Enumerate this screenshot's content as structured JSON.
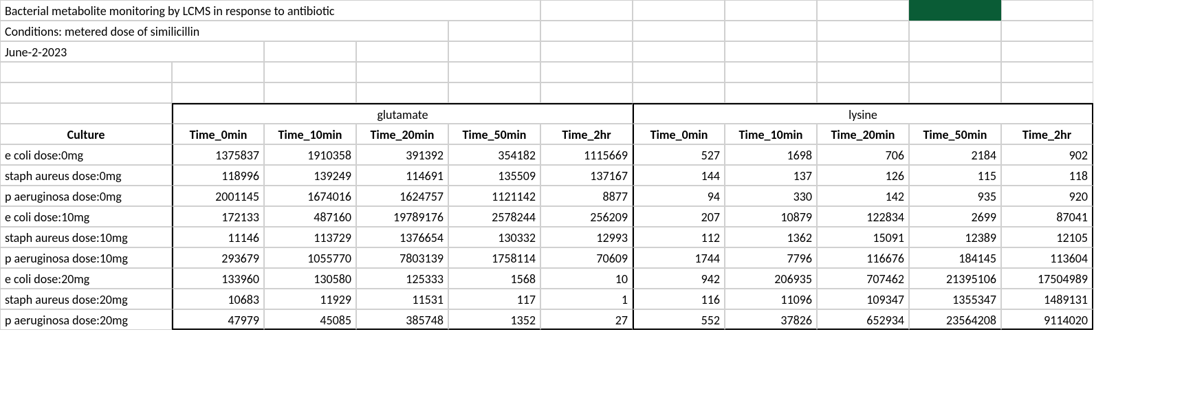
{
  "meta": {
    "title": "Bacterial metabolite monitoring by LCMS in response to antibiotic",
    "conditions": "Conditions: metered dose of similicillin",
    "date": "June-2-2023"
  },
  "groups": [
    "glutamate",
    "lysine"
  ],
  "culture_label": "Culture",
  "time_headers": [
    "Time_0min",
    "Time_10min",
    "Time_20min",
    "Time_50min",
    "Time_2hr"
  ],
  "rows": [
    {
      "culture": "e coli dose:0mg",
      "glutamate": [
        "1375837",
        "1910358",
        "391392",
        "354182",
        "1115669"
      ],
      "lysine": [
        "527",
        "1698",
        "706",
        "2184",
        "902"
      ]
    },
    {
      "culture": "staph aureus dose:0mg",
      "glutamate": [
        "118996",
        "139249",
        "114691",
        "135509",
        "137167"
      ],
      "lysine": [
        "144",
        "137",
        "126",
        "115",
        "118"
      ]
    },
    {
      "culture": "p aeruginosa dose:0mg",
      "glutamate": [
        "2001145",
        "1674016",
        "1624757",
        "1121142",
        "8877"
      ],
      "lysine": [
        "94",
        "330",
        "142",
        "935",
        "920"
      ]
    },
    {
      "culture": "e coli dose:10mg",
      "glutamate": [
        "172133",
        "487160",
        "19789176",
        "2578244",
        "256209"
      ],
      "lysine": [
        "207",
        "10879",
        "122834",
        "2699",
        "87041"
      ]
    },
    {
      "culture": "staph aureus dose:10mg",
      "glutamate": [
        "11146",
        "113729",
        "1376654",
        "130332",
        "12993"
      ],
      "lysine": [
        "112",
        "1362",
        "15091",
        "12389",
        "12105"
      ]
    },
    {
      "culture": "p aeruginosa dose:10mg",
      "glutamate": [
        "293679",
        "1055770",
        "7803139",
        "1758114",
        "70609"
      ],
      "lysine": [
        "1744",
        "7796",
        "116676",
        "184145",
        "113604"
      ]
    },
    {
      "culture": "e coli dose:20mg",
      "glutamate": [
        "133960",
        "130580",
        "125333",
        "1568",
        "10"
      ],
      "lysine": [
        "942",
        "206935",
        "707462",
        "21395106",
        "17504989"
      ]
    },
    {
      "culture": "staph aureus dose:20mg",
      "glutamate": [
        "10683",
        "11929",
        "11531",
        "117",
        "1"
      ],
      "lysine": [
        "116",
        "11096",
        "109347",
        "1355347",
        "1489131"
      ]
    },
    {
      "culture": "p aeruginosa dose:20mg",
      "glutamate": [
        "47979",
        "45085",
        "385748",
        "1352",
        "27"
      ],
      "lysine": [
        "552",
        "37826",
        "652934",
        "23564208",
        "9114020"
      ]
    }
  ]
}
